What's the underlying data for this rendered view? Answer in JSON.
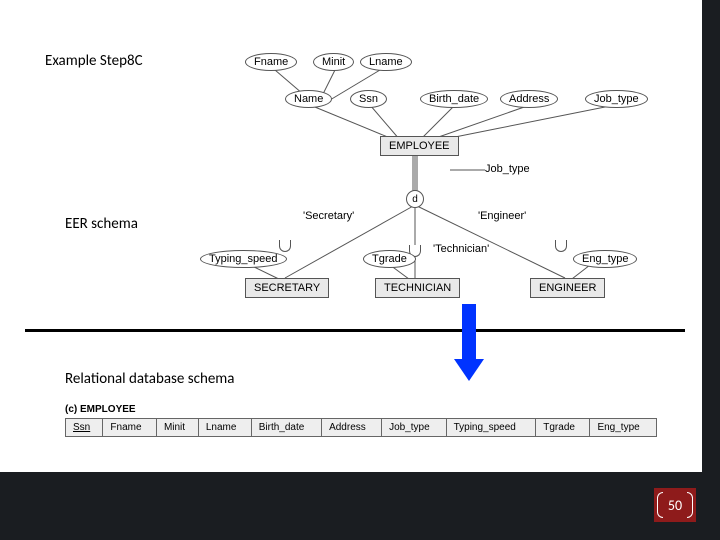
{
  "title": "Example Step8C",
  "labels": {
    "eer": "EER schema",
    "relational": "Relational database schema"
  },
  "eer": {
    "top_attrs": {
      "fname": "Fname",
      "minit": "Minit",
      "lname": "Lname"
    },
    "mid_attrs": {
      "name": "Name",
      "ssn": "Ssn",
      "birth_date": "Birth_date",
      "address": "Address",
      "job_type": "Job_type"
    },
    "entity": "EMPLOYEE",
    "link_attr": "Job_type",
    "d": "d",
    "disc": {
      "secretary": "'Secretary'",
      "technician": "'Technician'",
      "engineer": "'Engineer'"
    },
    "sub_attrs": {
      "typing_speed": "Typing_speed",
      "tgrade": "Tgrade",
      "eng_type": "Eng_type"
    },
    "sub_entities": {
      "secretary": "SECRETARY",
      "technician": "TECHNICIAN",
      "engineer": "ENGINEER"
    }
  },
  "table": {
    "option": "(c)",
    "name": "EMPLOYEE",
    "cols": [
      "Ssn",
      "Fname",
      "Minit",
      "Lname",
      "Birth_date",
      "Address",
      "Job_type",
      "Typing_speed",
      "Tgrade",
      "Eng_type"
    ]
  },
  "page": "50"
}
